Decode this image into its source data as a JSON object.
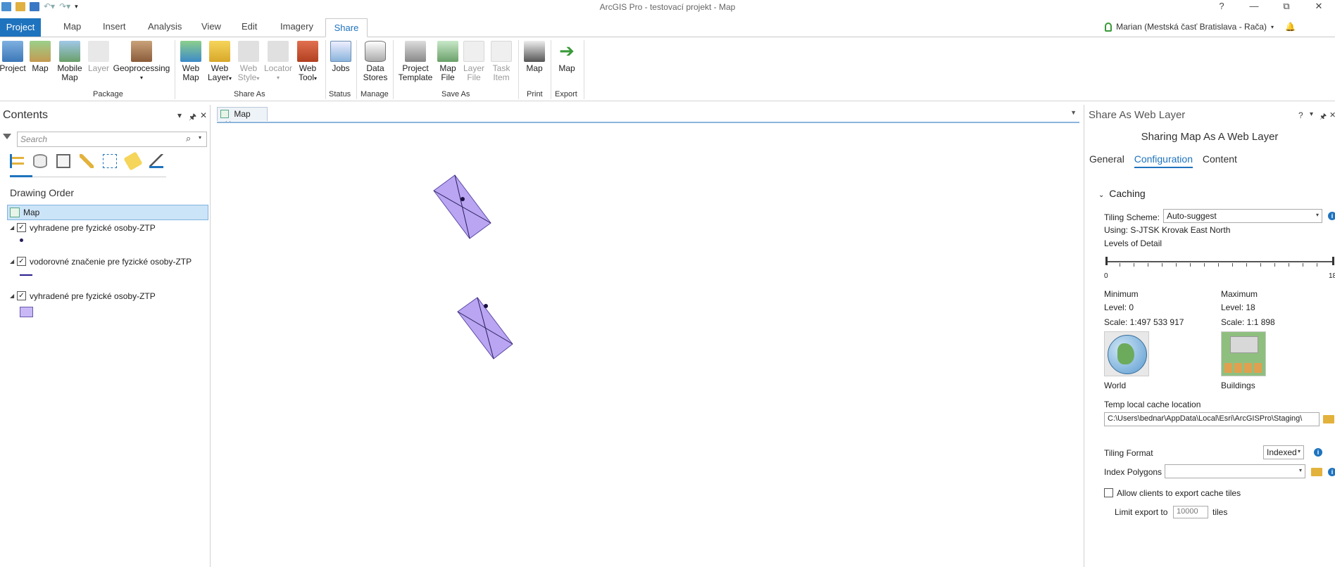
{
  "app_title": "ArcGIS Pro - testovací projekt - Map",
  "window_controls": {
    "help": "?",
    "minimize": "—",
    "restore": "⧉",
    "close": "✕"
  },
  "tabs": [
    "Project",
    "Map",
    "Insert",
    "Analysis",
    "View",
    "Edit",
    "Imagery",
    "Share"
  ],
  "active_tab": "Share",
  "user": "Marian (Mestská časť Bratislava - Rača)",
  "ribbon": {
    "package": {
      "label": "Package",
      "buttons": [
        "Project",
        "Map",
        "Mobile\nMap",
        "Layer",
        "Geoprocessing"
      ]
    },
    "share_as": {
      "label": "Share As",
      "buttons": [
        "Web\nMap",
        "Web\nLayer",
        "Web\nStyle",
        "Locator",
        "Web\nTool"
      ]
    },
    "status": {
      "label": "Status",
      "buttons": [
        "Jobs"
      ]
    },
    "manage": {
      "label": "Manage",
      "buttons": [
        "Data\nStores"
      ]
    },
    "save_as": {
      "label": "Save As",
      "buttons": [
        "Project\nTemplate",
        "Map\nFile",
        "Layer\nFile",
        "Task\nItem"
      ]
    },
    "print": {
      "label": "Print",
      "buttons": [
        "Map"
      ]
    },
    "export": {
      "label": "Export",
      "buttons": [
        "Map"
      ]
    }
  },
  "contents": {
    "title": "Contents",
    "search_placeholder": "Search",
    "drawing_order": "Drawing Order",
    "map_label": "Map",
    "layers": [
      {
        "name": "vyhradene pre fyzické osoby-ZTP",
        "checked": true,
        "symbol": "point"
      },
      {
        "name": "vodorovné značenie pre fyzické osoby-ZTP",
        "checked": true,
        "symbol": "line"
      },
      {
        "name": "vyhradené pre fyzické osoby-ZTP",
        "checked": true,
        "symbol": "polygon"
      }
    ]
  },
  "map_tab": "Map",
  "share_pane": {
    "title": "Share As Web Layer",
    "subtitle": "Sharing Map As A Web Layer",
    "tabs": [
      "General",
      "Configuration",
      "Content"
    ],
    "active_tab": "Configuration",
    "section": "Caching",
    "tiling_scheme_label": "Tiling Scheme:",
    "tiling_scheme_value": "Auto-suggest",
    "using": "Using:  S-JTSK Krovak East North",
    "lod_label": "Levels of Detail",
    "lod_min_tick": "0",
    "lod_max_tick": "18",
    "min": {
      "title": "Minimum",
      "level": "Level:  0",
      "scale": "Scale:  1:497 533 917",
      "caption": "World"
    },
    "max": {
      "title": "Maximum",
      "level": "Level:  18",
      "scale": "Scale:  1:1 898",
      "caption": "Buildings"
    },
    "cache_location_label": "Temp local cache location",
    "cache_location_value": "C:\\Users\\bednar\\AppData\\Local\\Esri\\ArcGISPro\\Staging\\",
    "tiling_format_label": "Tiling Format",
    "tiling_format_value": "Indexed",
    "index_polygons_label": "Index Polygons",
    "index_polygons_value": "",
    "allow_export_label": "Allow clients to export cache tiles",
    "limit_export_label": "Limit export to",
    "limit_export_value": "10000",
    "limit_export_unit": "tiles"
  },
  "colors": {
    "accent": "#1e73be",
    "polygon_fill": "#b9a5f2",
    "polygon_stroke": "#5e4aa8"
  }
}
